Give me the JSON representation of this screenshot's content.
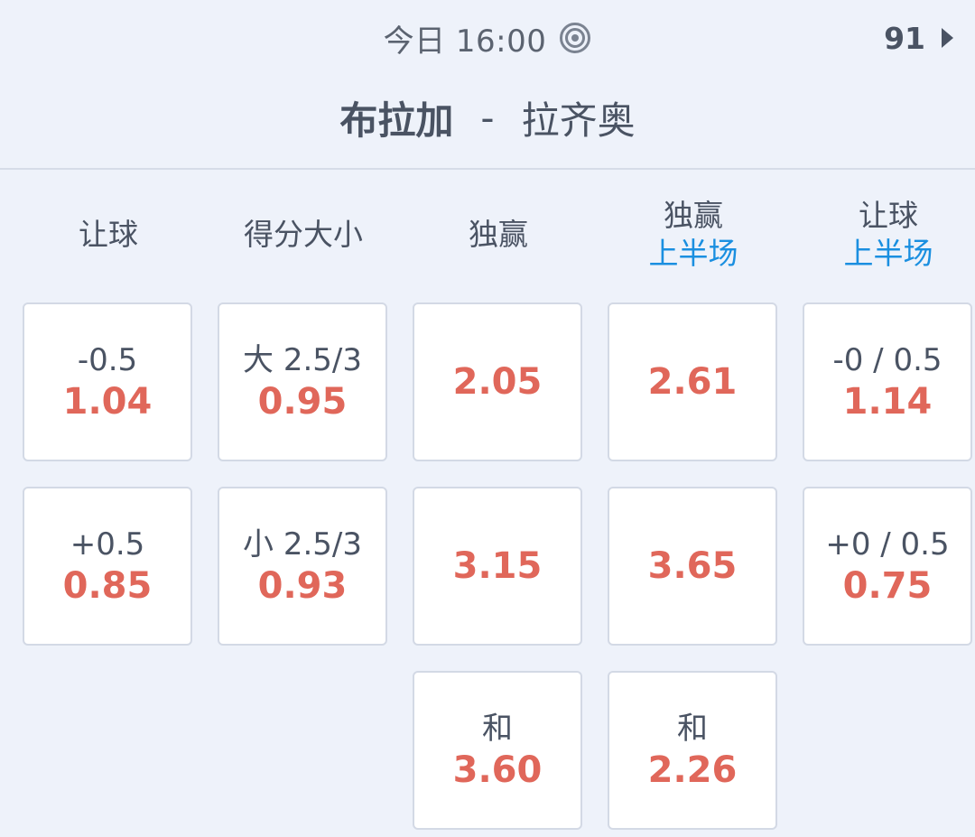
{
  "header": {
    "time": "今日 16:00",
    "count": "91",
    "home_team": "布拉加",
    "separator": "-",
    "away_team": "拉齐奥"
  },
  "columns": [
    {
      "title": "让球",
      "sub": ""
    },
    {
      "title": "得分大小",
      "sub": ""
    },
    {
      "title": "独赢",
      "sub": ""
    },
    {
      "title": "独赢",
      "sub": "上半场"
    },
    {
      "title": "让球",
      "sub": "上半场"
    }
  ],
  "cells": {
    "handicap_home": {
      "line": "-0.5",
      "odds": "1.04"
    },
    "handicap_away": {
      "line": "+0.5",
      "odds": "0.85"
    },
    "total_over": {
      "line": "大 2.5/3",
      "odds": "0.95"
    },
    "total_under": {
      "line": "小 2.5/3",
      "odds": "0.93"
    },
    "win_home": {
      "odds": "2.05"
    },
    "win_away": {
      "odds": "3.15"
    },
    "win_draw": {
      "line": "和",
      "odds": "3.60"
    },
    "ht_win_home": {
      "odds": "2.61"
    },
    "ht_win_away": {
      "odds": "3.65"
    },
    "ht_win_draw": {
      "line": "和",
      "odds": "2.26"
    },
    "ht_handicap_home": {
      "line": "-0 / 0.5",
      "odds": "1.14"
    },
    "ht_handicap_away": {
      "line": "+0 / 0.5",
      "odds": "0.75"
    }
  },
  "icons": {
    "live": "live-broadcast-icon",
    "arrow": "chevron-right-icon"
  },
  "colors": {
    "odds": "#e0675a",
    "accent": "#1a8fe0",
    "background": "#eef2fa"
  }
}
